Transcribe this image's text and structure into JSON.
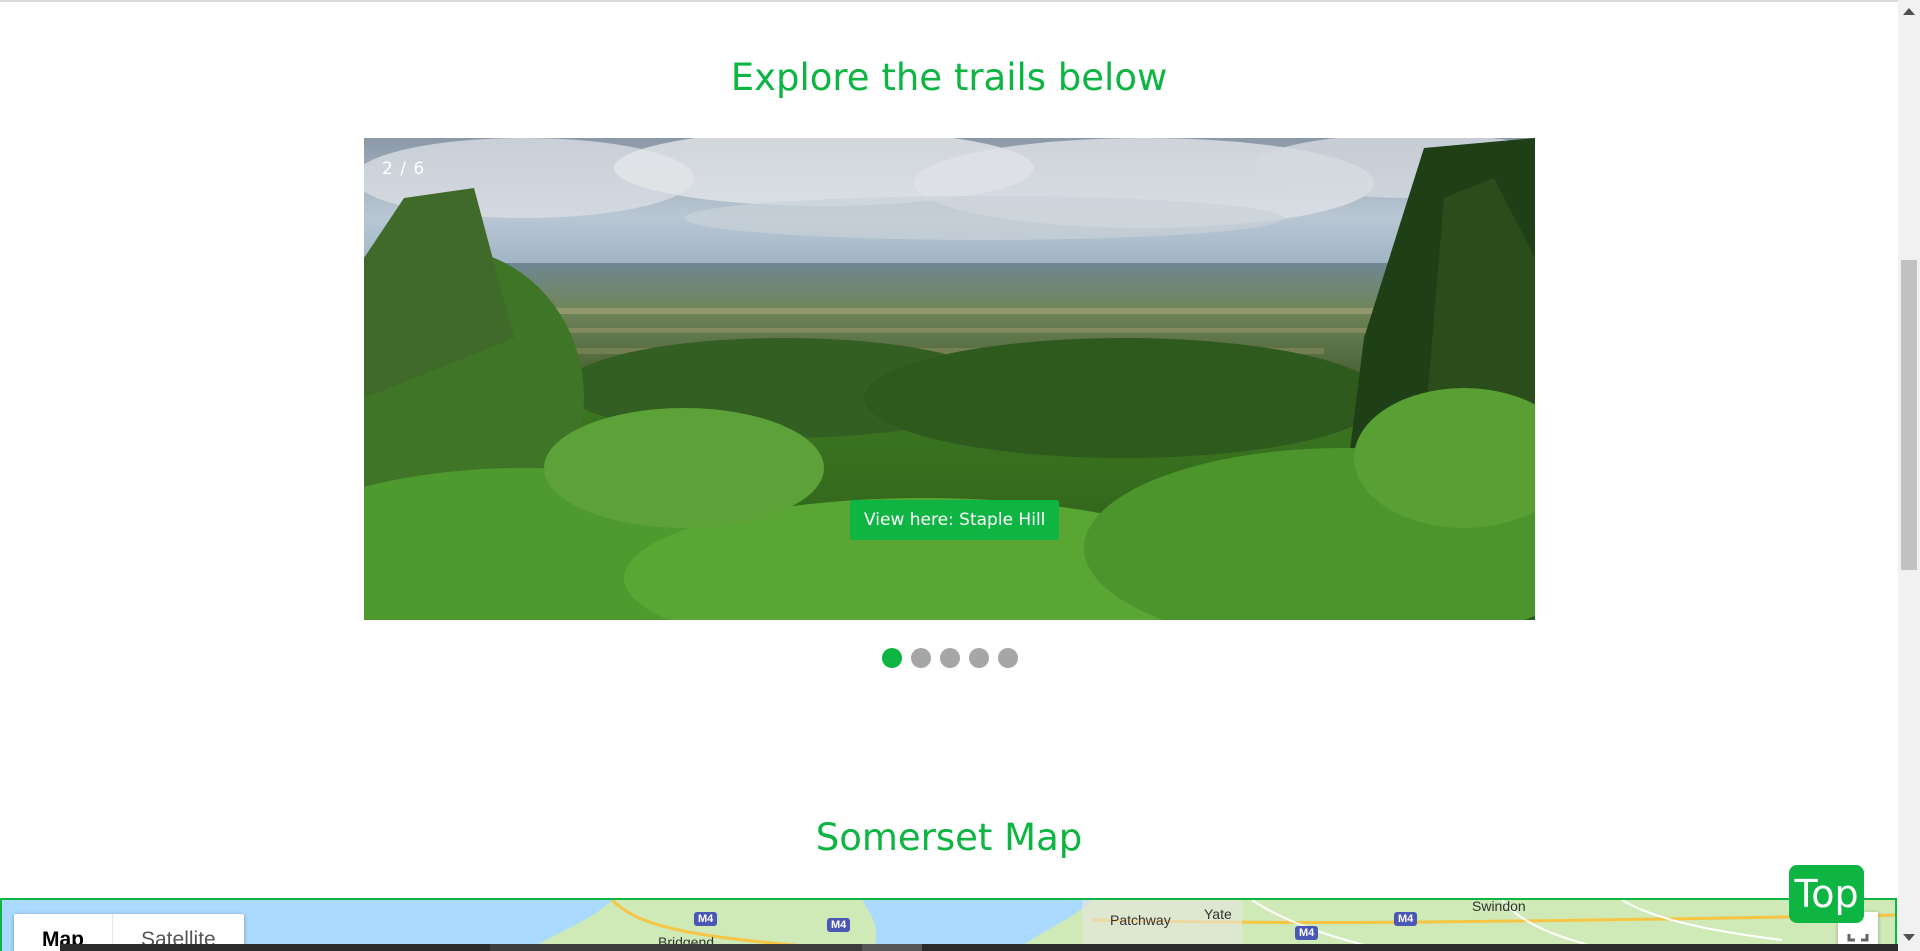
{
  "trails_section": {
    "title": "Explore the trails below",
    "slideshow": {
      "counter": "2 / 6",
      "caption_button": "View here: Staple Hill",
      "dots_count": 5,
      "active_dot": 1
    }
  },
  "map_section": {
    "title": "Somerset Map",
    "map_type_tabs": [
      "Map",
      "Satellite"
    ],
    "selected_tab": "Map",
    "place_labels": [
      "Patchway",
      "Yate",
      "Swindon",
      "Bridgend"
    ],
    "road_shields": [
      "M4",
      "M4",
      "M4",
      "M4"
    ]
  },
  "back_to_top": {
    "label": "Top"
  },
  "colors": {
    "accent": "#0fb543",
    "inactive_dot": "#a6a6a6"
  },
  "icons": [
    "fullscreen-icon",
    "scroll-up-arrow-icon",
    "scroll-down-arrow-icon"
  ]
}
